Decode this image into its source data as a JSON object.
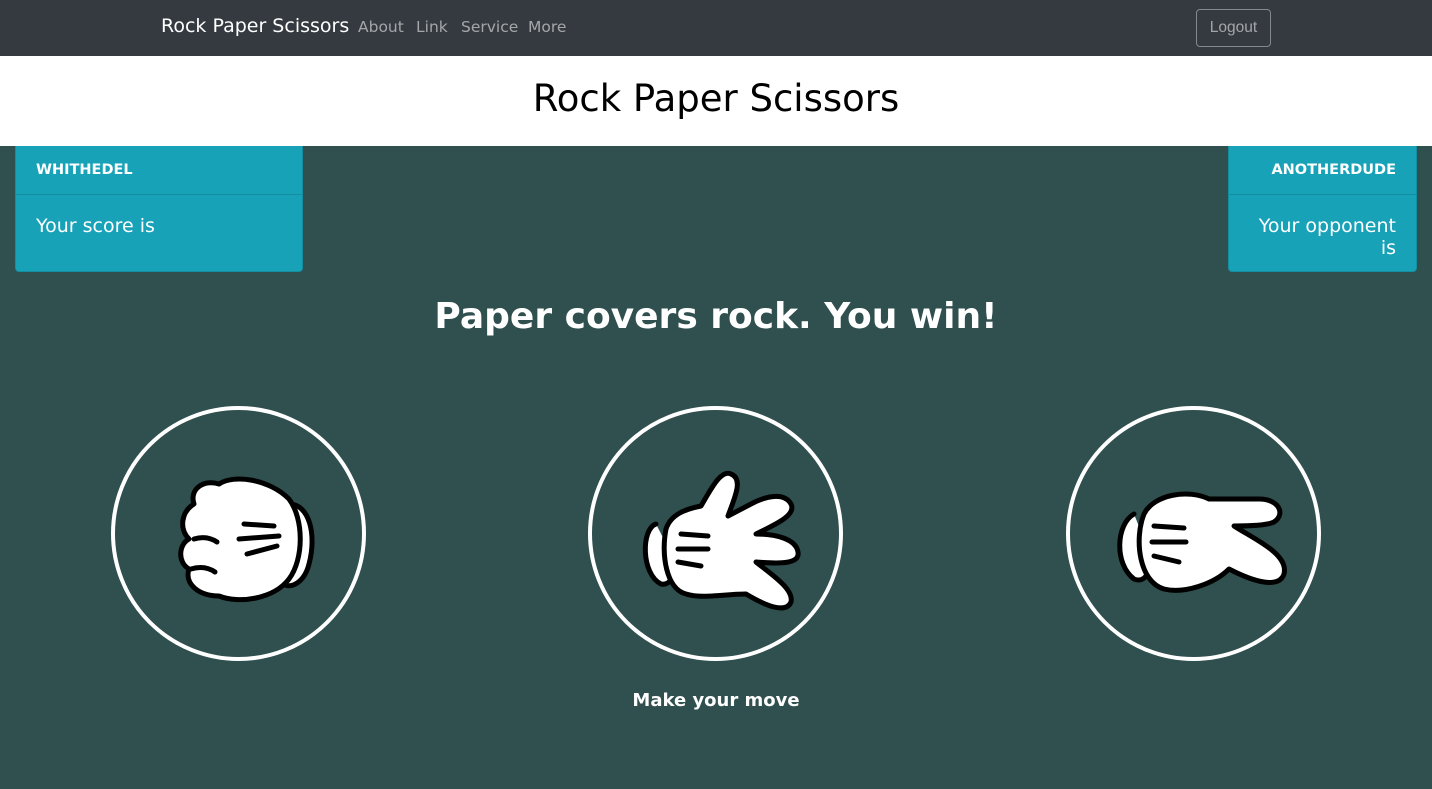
{
  "navbar": {
    "brand": "Rock Paper Scissors",
    "links": [
      "About",
      "Link",
      "Service",
      "More"
    ],
    "logout_label": "Logout"
  },
  "header": {
    "title": "Rock Paper Scissors"
  },
  "player": {
    "name": "whithedel",
    "score_text": "Your score is"
  },
  "opponent": {
    "name": "anotherdude",
    "text": "Your opponent is"
  },
  "result": "Paper covers rock. You win!",
  "choices": [
    {
      "name": "rock",
      "icon": "rock-hand-icon"
    },
    {
      "name": "paper",
      "icon": "paper-hand-icon"
    },
    {
      "name": "scissors",
      "icon": "scissors-hand-icon"
    }
  ],
  "prompt": "Make your move",
  "colors": {
    "navbar": "#343a40",
    "background": "#304f4f",
    "card": "#17a2b8",
    "circle": "#ffffff"
  }
}
